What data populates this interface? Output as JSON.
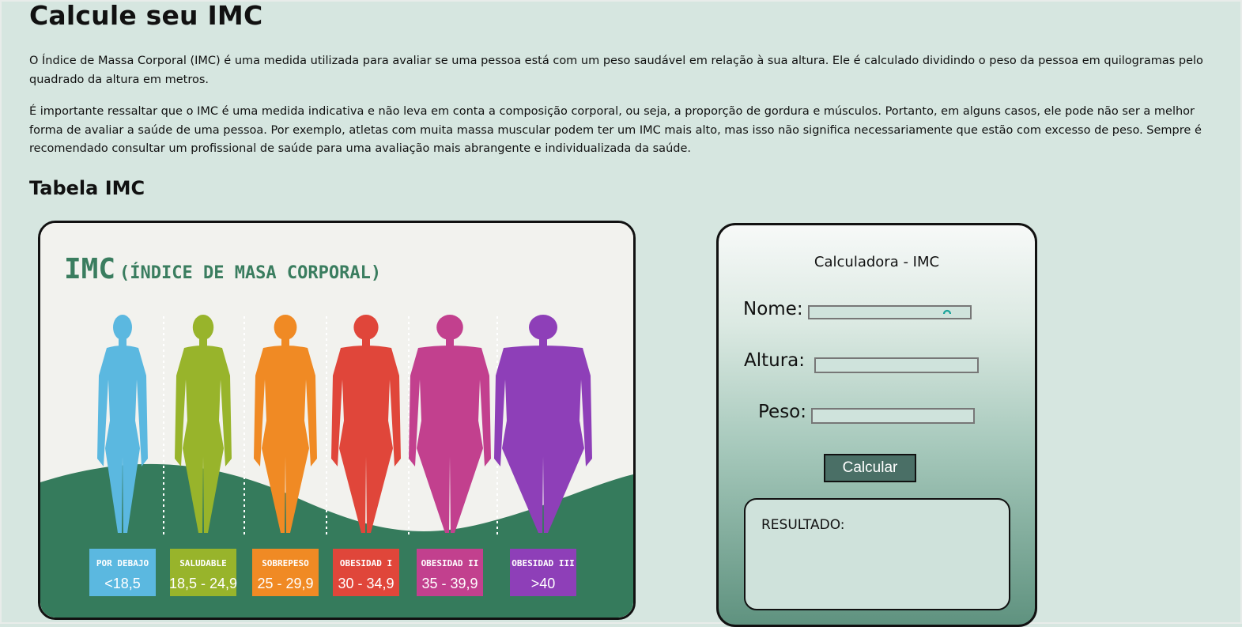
{
  "header": {
    "title": "Calcule seu IMC",
    "paragraph1": "O Índice de Massa Corporal (IMC) é uma medida utilizada para avaliar se uma pessoa está com um peso saudável em relação à sua altura. Ele é calculado dividindo o peso da pessoa em quilogramas pelo quadrado da altura em metros.",
    "paragraph2": "É importante ressaltar que o IMC é uma medida indicativa e não leva em conta a composição corporal, ou seja, a proporção de gordura e músculos. Portanto, em alguns casos, ele pode não ser a melhor forma de avaliar a saúde de uma pessoa. Por exemplo, atletas com muita massa muscular podem ter um IMC mais alto, mas isso não significa necessariamente que estão com excesso de peso. Sempre é recomendado consultar um profissional de saúde para uma avaliação mais abrangente e individualizada da saúde."
  },
  "table_section": {
    "heading": "Tabela IMC",
    "image": {
      "title_main": "IMC",
      "title_sub": "(ÍNDICE DE MASA CORPORAL)",
      "categories": [
        {
          "label": "POR DEBAJO",
          "range": "<18,5",
          "color": "#5bb8e0"
        },
        {
          "label": "SALUDABLE",
          "range": "18,5 - 24,9",
          "color": "#98b42b"
        },
        {
          "label": "SOBREPESO",
          "range": "25 - 29,9",
          "color": "#f08a24"
        },
        {
          "label": "OBESIDAD I",
          "range": "30 - 34,9",
          "color": "#e0463a"
        },
        {
          "label": "OBESIDAD II",
          "range": "35 - 39,9",
          "color": "#c2408e"
        },
        {
          "label": "OBESIDAD III",
          "range": ">40",
          "color": "#8e3fb8"
        }
      ],
      "title_color": "#3a7d5f",
      "hill_color": "#357b5c"
    }
  },
  "calculator": {
    "title": "Calculadora - IMC",
    "nome_label": "Nome:",
    "altura_label": "Altura:",
    "peso_label": "Peso:",
    "nome_value": "",
    "altura_value": "",
    "peso_value": "",
    "button_label": "Calcular",
    "result_label": "RESULTADO:",
    "icons": {
      "loading": "loading-spinner-icon"
    }
  }
}
